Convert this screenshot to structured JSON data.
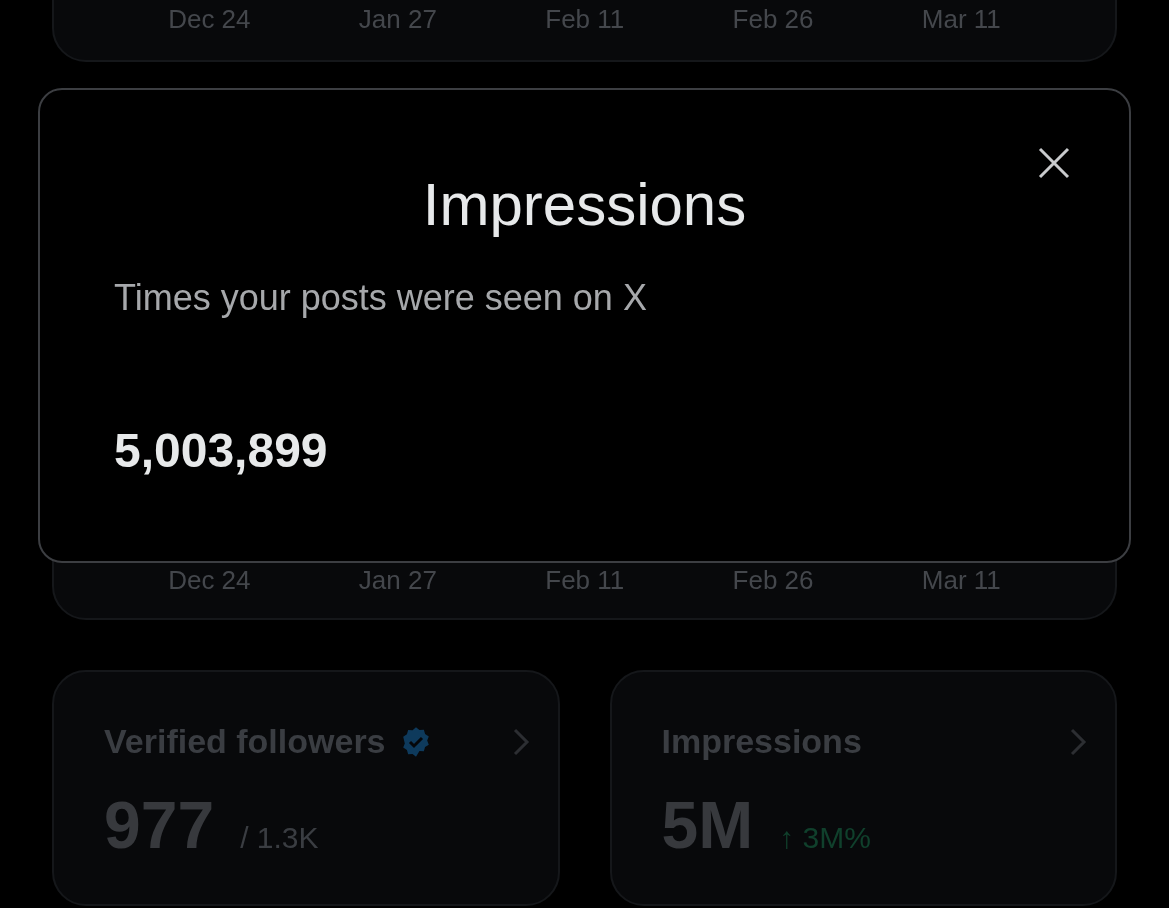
{
  "top_chart": {
    "axis_labels": [
      "Dec 24",
      "Jan 27",
      "Feb 11",
      "Feb 26",
      "Mar 11"
    ]
  },
  "middle_chart": {
    "axis_labels": [
      "Dec 24",
      "Jan 27",
      "Feb 11",
      "Feb 26",
      "Mar 11"
    ]
  },
  "dialog": {
    "title": "Impressions",
    "description": "Times your posts were seen on X",
    "value": "5,003,899"
  },
  "stat_cards": [
    {
      "label": "Verified followers",
      "verified": true,
      "value": "977",
      "suffix": "/ 1.3K"
    },
    {
      "label": "Impressions",
      "verified": false,
      "value": "5M",
      "change": "↑ 3M%"
    }
  ]
}
